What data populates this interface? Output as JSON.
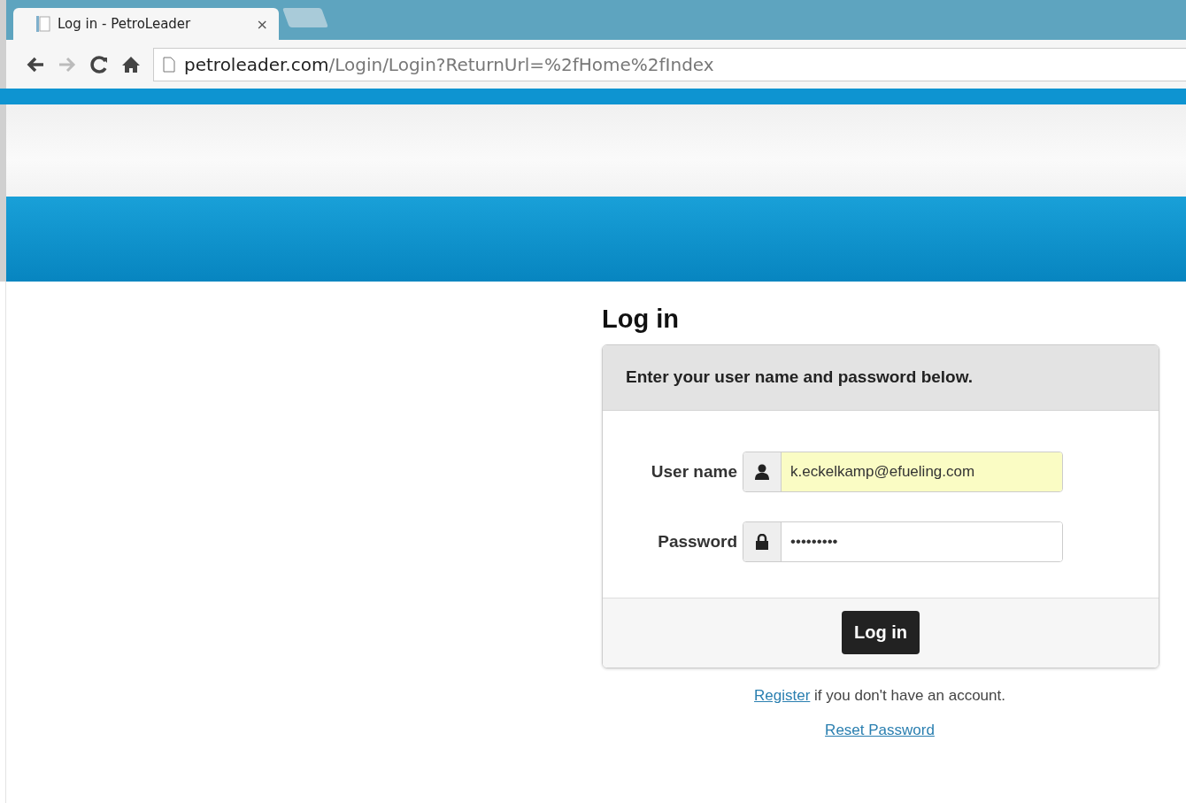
{
  "browser": {
    "tab_title": "Log in - PetroLeader",
    "tab_close": "×",
    "url_host": "petroleader.com",
    "url_path": "/Login/Login?ReturnUrl=%2fHome%2fIndex"
  },
  "login": {
    "heading": "Log in",
    "instructions": "Enter your user name and password below.",
    "fields": [
      {
        "kind": "user",
        "label": "User name",
        "value": "k.eckelkamp@efueling.com",
        "autofilled": true
      },
      {
        "kind": "password",
        "label": "Password",
        "value": "•••••••••",
        "autofilled": false
      }
    ],
    "submit": "Log in",
    "register_link": "Register",
    "register_text": " if you don't have an account.",
    "reset_link": "Reset Password"
  }
}
